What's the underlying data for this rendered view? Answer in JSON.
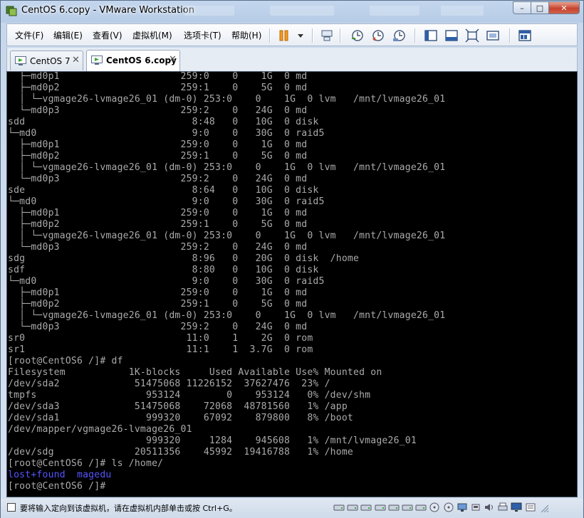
{
  "window": {
    "title": "CentOS 6.copy - VMware Workstation",
    "controls": {
      "minimize": "–",
      "maximize": "□",
      "close": "✕"
    }
  },
  "menu": [
    "文件(F)",
    "编辑(E)",
    "查看(V)",
    "虚拟机(M)",
    "选项卡(T)",
    "帮助(H)"
  ],
  "toolbar_icons": [
    "pause-icon",
    "dropdown-arrow-icon",
    "send-ctrl-alt-del-icon",
    "snapshot-take-icon",
    "snapshot-revert-icon",
    "snapshot-manager-icon",
    "sidebar-toggle-icon",
    "console-view-icon",
    "fullscreen-icon",
    "unity-icon",
    "thumbnail-icon"
  ],
  "tabs": [
    {
      "label": "CentOS 7",
      "close": "✕",
      "active": false
    },
    {
      "label": "CentOS 6.copy",
      "close": "✕",
      "active": true
    }
  ],
  "console": {
    "lines": [
      "  ├─md0p1                     259:0    0    1G  0 md",
      "  ├─md0p2                     259:1    0    5G  0 md",
      "  │ └─vgmage26-lvmage26_01 (dm-0) 253:0    0    1G  0 lvm   /mnt/lvmage26_01",
      "  └─md0p3                     259:2    0   24G  0 md",
      "sdd                             8:48   0   10G  0 disk",
      "└─md0                           9:0    0   30G  0 raid5",
      "  ├─md0p1                     259:0    0    1G  0 md",
      "  ├─md0p2                     259:1    0    5G  0 md",
      "  │ └─vgmage26-lvmage26_01 (dm-0) 253:0    0    1G  0 lvm   /mnt/lvmage26_01",
      "  └─md0p3                     259:2    0   24G  0 md",
      "sde                             8:64   0   10G  0 disk",
      "└─md0                           9:0    0   30G  0 raid5",
      "  ├─md0p1                     259:0    0    1G  0 md",
      "  ├─md0p2                     259:1    0    5G  0 md",
      "  │ └─vgmage26-lvmage26_01 (dm-0) 253:0    0    1G  0 lvm   /mnt/lvmage26_01",
      "  └─md0p3                     259:2    0   24G  0 md",
      "sdg                             8:96   0   20G  0 disk  /home",
      "sdf                             8:80   0   10G  0 disk",
      "└─md0                           9:0    0   30G  0 raid5",
      "  ├─md0p1                     259:0    0    1G  0 md",
      "  ├─md0p2                     259:1    0    5G  0 md",
      "  │ └─vgmage26-lvmage26_01 (dm-0) 253:0    0    1G  0 lvm   /mnt/lvmage26_01",
      "  └─md0p3                     259:2    0   24G  0 md",
      "sr0                            11:0    1    2G  0 rom",
      "sr1                            11:1    1  3.7G  0 rom",
      "[root@CentOS6 /]# df",
      "Filesystem           1K-blocks     Used Available Use% Mounted on",
      "/dev/sda2             51475068 11226152  37627476  23% /",
      "tmpfs                   953124        0    953124   0% /dev/shm",
      "/dev/sda3             51475068    72068  48781560   1% /app",
      "/dev/sda1               999320    67092    879800   8% /boot",
      "/dev/mapper/vgmage26-lvmage26_01",
      "                        999320     1284    945608   1% /mnt/lvmage26_01",
      "/dev/sdg              20511356    45992  19416788   1% /home",
      "[root@CentOS6 /]# ls /home/",
      "lost+found  magedu",
      "[root@CentOS6 /]#"
    ],
    "blue_line_index": 35
  },
  "statusbar": {
    "text": "要将输入定向到该虚拟机，请在虚拟机内部单击或按 Ctrl+G。"
  }
}
